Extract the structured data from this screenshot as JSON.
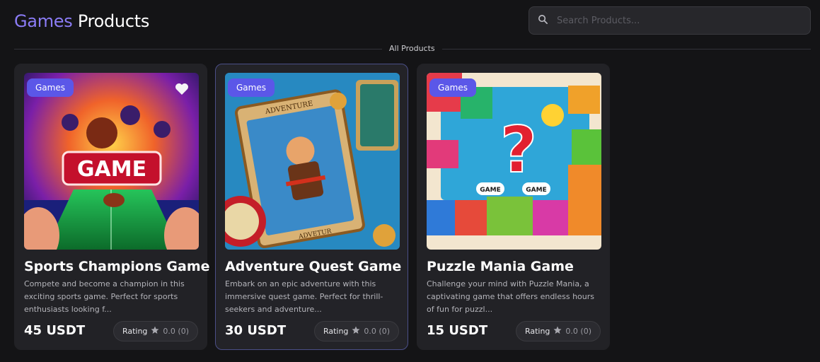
{
  "header": {
    "title_accent": "Games",
    "title_rest": "Products",
    "search_placeholder": "Search Products..."
  },
  "section_label": "All Products",
  "products": [
    {
      "badge": "Games",
      "title": "Sports Champions Game",
      "description": "Compete and become a champion in this exciting sports game. Perfect for sports enthusiasts looking f...",
      "price": "45 USDT",
      "rating_label": "Rating",
      "rating_value": "0.0 (0)",
      "image_icon": "sports-game-art"
    },
    {
      "badge": "Games",
      "title": "Adventure Quest Game",
      "description": "Embark on an epic adventure with this immersive quest game. Perfect for thrill-seekers and adventure...",
      "price": "30 USDT",
      "rating_label": "Rating",
      "rating_value": "0.0 (0)",
      "image_icon": "adventure-card-art"
    },
    {
      "badge": "Games",
      "title": "Puzzle Mania Game",
      "description": "Challenge your mind with Puzzle Mania, a captivating game that offers endless hours of fun for puzzl...",
      "price": "15 USDT",
      "rating_label": "Rating",
      "rating_value": "0.0 (0)",
      "image_icon": "puzzle-art"
    }
  ],
  "image_texts": {
    "sports": "GAME",
    "adventure_top": "ADVENTURE",
    "adventure_bottom": "ADVETUR",
    "puzzle_left": "GAME",
    "puzzle_right": "GAME"
  },
  "colors": {
    "accent": "#8b7cf6",
    "badge": "#5b57e8",
    "background": "#141416",
    "card": "#222226"
  }
}
